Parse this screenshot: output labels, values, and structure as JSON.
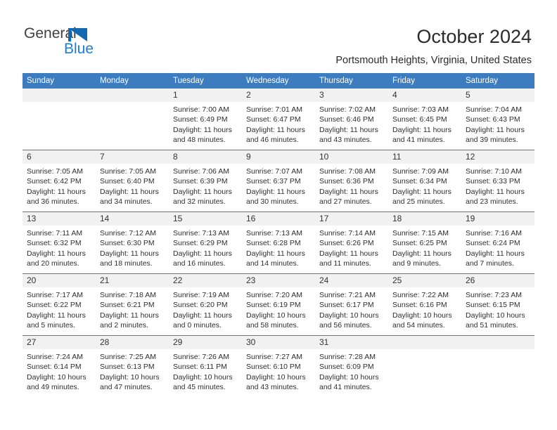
{
  "logo": {
    "text_top": "General",
    "text_bottom": "Blue",
    "triangle_icon": "blue-triangle-icon",
    "accent_color": "#1269b0",
    "blue_text_color": "#1a7fd4"
  },
  "header": {
    "title": "October 2024",
    "subtitle": "Portsmouth Heights, Virginia, United States"
  },
  "theme": {
    "header_blue": "#3c7cbf",
    "daynum_band": "#f1f1f1",
    "text": "#2e2e2e"
  },
  "calendar": {
    "weekday_headers": [
      "Sunday",
      "Monday",
      "Tuesday",
      "Wednesday",
      "Thursday",
      "Friday",
      "Saturday"
    ],
    "weeks": [
      {
        "days": [
          {
            "num": "",
            "sunrise": "",
            "sunset": "",
            "daylight_line1": "",
            "daylight_line2": ""
          },
          {
            "num": "",
            "sunrise": "",
            "sunset": "",
            "daylight_line1": "",
            "daylight_line2": ""
          },
          {
            "num": "1",
            "sunrise": "Sunrise: 7:00 AM",
            "sunset": "Sunset: 6:49 PM",
            "daylight_line1": "Daylight: 11 hours",
            "daylight_line2": "and 48 minutes."
          },
          {
            "num": "2",
            "sunrise": "Sunrise: 7:01 AM",
            "sunset": "Sunset: 6:47 PM",
            "daylight_line1": "Daylight: 11 hours",
            "daylight_line2": "and 46 minutes."
          },
          {
            "num": "3",
            "sunrise": "Sunrise: 7:02 AM",
            "sunset": "Sunset: 6:46 PM",
            "daylight_line1": "Daylight: 11 hours",
            "daylight_line2": "and 43 minutes."
          },
          {
            "num": "4",
            "sunrise": "Sunrise: 7:03 AM",
            "sunset": "Sunset: 6:45 PM",
            "daylight_line1": "Daylight: 11 hours",
            "daylight_line2": "and 41 minutes."
          },
          {
            "num": "5",
            "sunrise": "Sunrise: 7:04 AM",
            "sunset": "Sunset: 6:43 PM",
            "daylight_line1": "Daylight: 11 hours",
            "daylight_line2": "and 39 minutes."
          }
        ]
      },
      {
        "days": [
          {
            "num": "6",
            "sunrise": "Sunrise: 7:05 AM",
            "sunset": "Sunset: 6:42 PM",
            "daylight_line1": "Daylight: 11 hours",
            "daylight_line2": "and 36 minutes."
          },
          {
            "num": "7",
            "sunrise": "Sunrise: 7:05 AM",
            "sunset": "Sunset: 6:40 PM",
            "daylight_line1": "Daylight: 11 hours",
            "daylight_line2": "and 34 minutes."
          },
          {
            "num": "8",
            "sunrise": "Sunrise: 7:06 AM",
            "sunset": "Sunset: 6:39 PM",
            "daylight_line1": "Daylight: 11 hours",
            "daylight_line2": "and 32 minutes."
          },
          {
            "num": "9",
            "sunrise": "Sunrise: 7:07 AM",
            "sunset": "Sunset: 6:37 PM",
            "daylight_line1": "Daylight: 11 hours",
            "daylight_line2": "and 30 minutes."
          },
          {
            "num": "10",
            "sunrise": "Sunrise: 7:08 AM",
            "sunset": "Sunset: 6:36 PM",
            "daylight_line1": "Daylight: 11 hours",
            "daylight_line2": "and 27 minutes."
          },
          {
            "num": "11",
            "sunrise": "Sunrise: 7:09 AM",
            "sunset": "Sunset: 6:34 PM",
            "daylight_line1": "Daylight: 11 hours",
            "daylight_line2": "and 25 minutes."
          },
          {
            "num": "12",
            "sunrise": "Sunrise: 7:10 AM",
            "sunset": "Sunset: 6:33 PM",
            "daylight_line1": "Daylight: 11 hours",
            "daylight_line2": "and 23 minutes."
          }
        ]
      },
      {
        "days": [
          {
            "num": "13",
            "sunrise": "Sunrise: 7:11 AM",
            "sunset": "Sunset: 6:32 PM",
            "daylight_line1": "Daylight: 11 hours",
            "daylight_line2": "and 20 minutes."
          },
          {
            "num": "14",
            "sunrise": "Sunrise: 7:12 AM",
            "sunset": "Sunset: 6:30 PM",
            "daylight_line1": "Daylight: 11 hours",
            "daylight_line2": "and 18 minutes."
          },
          {
            "num": "15",
            "sunrise": "Sunrise: 7:13 AM",
            "sunset": "Sunset: 6:29 PM",
            "daylight_line1": "Daylight: 11 hours",
            "daylight_line2": "and 16 minutes."
          },
          {
            "num": "16",
            "sunrise": "Sunrise: 7:13 AM",
            "sunset": "Sunset: 6:28 PM",
            "daylight_line1": "Daylight: 11 hours",
            "daylight_line2": "and 14 minutes."
          },
          {
            "num": "17",
            "sunrise": "Sunrise: 7:14 AM",
            "sunset": "Sunset: 6:26 PM",
            "daylight_line1": "Daylight: 11 hours",
            "daylight_line2": "and 11 minutes."
          },
          {
            "num": "18",
            "sunrise": "Sunrise: 7:15 AM",
            "sunset": "Sunset: 6:25 PM",
            "daylight_line1": "Daylight: 11 hours",
            "daylight_line2": "and 9 minutes."
          },
          {
            "num": "19",
            "sunrise": "Sunrise: 7:16 AM",
            "sunset": "Sunset: 6:24 PM",
            "daylight_line1": "Daylight: 11 hours",
            "daylight_line2": "and 7 minutes."
          }
        ]
      },
      {
        "days": [
          {
            "num": "20",
            "sunrise": "Sunrise: 7:17 AM",
            "sunset": "Sunset: 6:22 PM",
            "daylight_line1": "Daylight: 11 hours",
            "daylight_line2": "and 5 minutes."
          },
          {
            "num": "21",
            "sunrise": "Sunrise: 7:18 AM",
            "sunset": "Sunset: 6:21 PM",
            "daylight_line1": "Daylight: 11 hours",
            "daylight_line2": "and 2 minutes."
          },
          {
            "num": "22",
            "sunrise": "Sunrise: 7:19 AM",
            "sunset": "Sunset: 6:20 PM",
            "daylight_line1": "Daylight: 11 hours",
            "daylight_line2": "and 0 minutes."
          },
          {
            "num": "23",
            "sunrise": "Sunrise: 7:20 AM",
            "sunset": "Sunset: 6:19 PM",
            "daylight_line1": "Daylight: 10 hours",
            "daylight_line2": "and 58 minutes."
          },
          {
            "num": "24",
            "sunrise": "Sunrise: 7:21 AM",
            "sunset": "Sunset: 6:17 PM",
            "daylight_line1": "Daylight: 10 hours",
            "daylight_line2": "and 56 minutes."
          },
          {
            "num": "25",
            "sunrise": "Sunrise: 7:22 AM",
            "sunset": "Sunset: 6:16 PM",
            "daylight_line1": "Daylight: 10 hours",
            "daylight_line2": "and 54 minutes."
          },
          {
            "num": "26",
            "sunrise": "Sunrise: 7:23 AM",
            "sunset": "Sunset: 6:15 PM",
            "daylight_line1": "Daylight: 10 hours",
            "daylight_line2": "and 51 minutes."
          }
        ]
      },
      {
        "days": [
          {
            "num": "27",
            "sunrise": "Sunrise: 7:24 AM",
            "sunset": "Sunset: 6:14 PM",
            "daylight_line1": "Daylight: 10 hours",
            "daylight_line2": "and 49 minutes."
          },
          {
            "num": "28",
            "sunrise": "Sunrise: 7:25 AM",
            "sunset": "Sunset: 6:13 PM",
            "daylight_line1": "Daylight: 10 hours",
            "daylight_line2": "and 47 minutes."
          },
          {
            "num": "29",
            "sunrise": "Sunrise: 7:26 AM",
            "sunset": "Sunset: 6:11 PM",
            "daylight_line1": "Daylight: 10 hours",
            "daylight_line2": "and 45 minutes."
          },
          {
            "num": "30",
            "sunrise": "Sunrise: 7:27 AM",
            "sunset": "Sunset: 6:10 PM",
            "daylight_line1": "Daylight: 10 hours",
            "daylight_line2": "and 43 minutes."
          },
          {
            "num": "31",
            "sunrise": "Sunrise: 7:28 AM",
            "sunset": "Sunset: 6:09 PM",
            "daylight_line1": "Daylight: 10 hours",
            "daylight_line2": "and 41 minutes."
          },
          {
            "num": "",
            "sunrise": "",
            "sunset": "",
            "daylight_line1": "",
            "daylight_line2": ""
          },
          {
            "num": "",
            "sunrise": "",
            "sunset": "",
            "daylight_line1": "",
            "daylight_line2": ""
          }
        ]
      }
    ]
  }
}
